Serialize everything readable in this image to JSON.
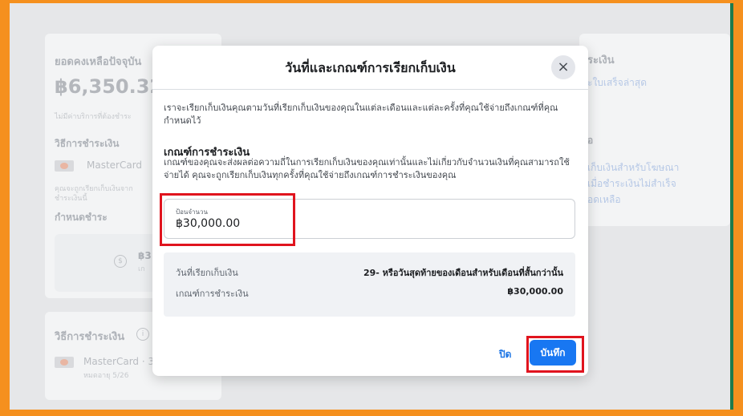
{
  "background": {
    "left_card": {
      "balance_label": "ยอดคงเหลือปัจจุบัน",
      "balance_value": "฿6,350.32",
      "note": "ไม่มีค่าบริการที่ต้องชำระ",
      "payment_method_label": "วิธีการชำระเงิน",
      "card_name": "MasterCard",
      "small_note_line1": "คุณจะถูกเรียกเก็บเงินจาก",
      "small_note_line2": "ชำระเงินนี้",
      "schedule_label": "กำหนดชำระ",
      "amount_partial": "฿3",
      "amount_sub": "เก"
    },
    "bottom_card": {
      "heading": "วิธีการชำระเงิน",
      "card_name": "MasterCard · 3",
      "expiry": "หมดอายุ 5/26"
    },
    "right_card": {
      "heading": "ระเงิน",
      "link": "ะใบเสร็จล่าสุด",
      "subheading": "อ",
      "line1": "เก็บเงินสำหรับโฆษณา",
      "line2": "เมื่อชำระเงินไม่สำเร็จ",
      "line3": "อดเหลือ"
    }
  },
  "modal": {
    "title": "วันที่และเกณฑ์การเรียกเก็บเงิน",
    "intro": "เราจะเรียกเก็บเงินคุณตามวันที่เรียกเก็บเงินของคุณในแต่ละเดือนและแต่ละครั้งที่คุณใช้จ่ายถึงเกณฑ์ที่คุณกำหนดไว้",
    "section_heading": "เกณฑ์การชำระเงิน",
    "section_desc": "เกณฑ์ของคุณจะส่งผลต่อความถี่ในการเรียกเก็บเงินของคุณเท่านั้นและไม่เกี่ยวกับจำนวนเงินที่คุณสามารถใช้จ่ายได้ คุณจะถูกเรียกเก็บเงินทุกครั้งที่คุณใช้จ่ายถึงเกณฑ์การชำระเงินของคุณ",
    "amount_field": {
      "label": "ป้อนจำนวน",
      "value": "฿30,000.00"
    },
    "summary": {
      "billing_date_label": "วันที่เรียกเก็บเงิน",
      "billing_date_value": "29- หรือวันสุดท้ายของเดือนสำหรับเดือนที่สั้นกว่านั้น",
      "threshold_label": "เกณฑ์การชำระเงิน",
      "threshold_value": "฿30,000.00"
    },
    "close_label": "ปิด",
    "save_label": "บันทึก",
    "close_icon": "×"
  },
  "colors": {
    "frame_border": "#f5901e",
    "highlight": "#e0141e",
    "primary_button": "#1877f2",
    "link": "#1b74e4"
  }
}
